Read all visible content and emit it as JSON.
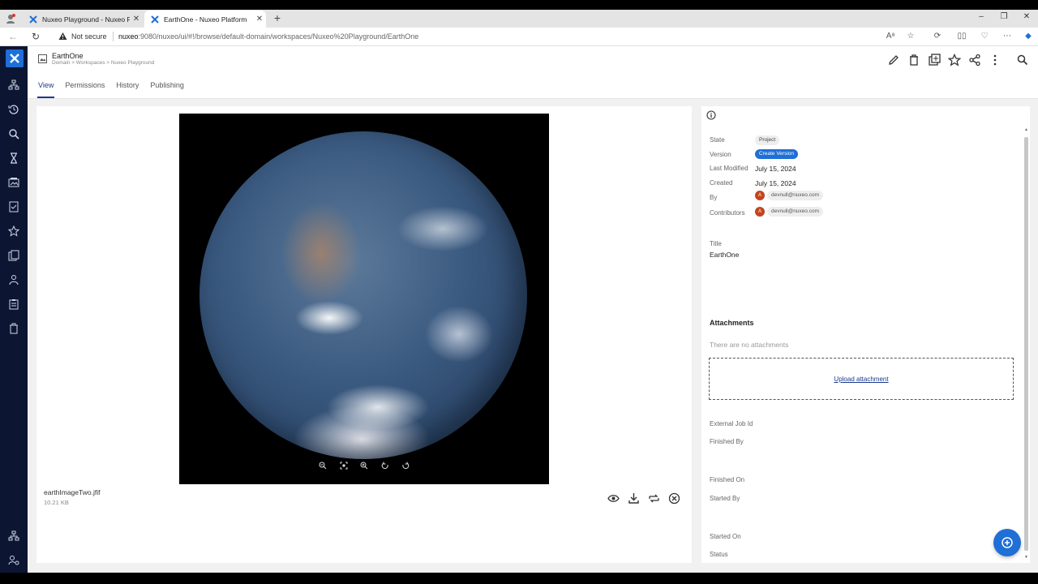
{
  "browser": {
    "tabs": [
      {
        "title": "Nuxeo Playground - Nuxeo Platf",
        "active": false
      },
      {
        "title": "EarthOne - Nuxeo Platform",
        "active": true
      }
    ],
    "security_label": "Not secure",
    "url_host": "nuxeo",
    "url_rest": ":9080/nuxeo/ui/#!/browse/default-domain/workspaces/Nuxeo%20Playground/EarthOne"
  },
  "document": {
    "title": "EarthOne",
    "breadcrumb": "Domain > Workspaces > Nuxeo Playground"
  },
  "view_tabs": [
    {
      "label": "View",
      "selected": true
    },
    {
      "label": "Permissions",
      "selected": false
    },
    {
      "label": "History",
      "selected": false
    },
    {
      "label": "Publishing",
      "selected": false
    }
  ],
  "viewer": {
    "file_name": "earthImageTwo.jfif",
    "file_size": "10.21 KB"
  },
  "panel": {
    "state_label": "State",
    "state_value": "Project",
    "version_label": "Version",
    "version_button": "Create Version",
    "last_modified_label": "Last Modified",
    "last_modified_value": "July 15, 2024",
    "created_label": "Created",
    "created_value": "July 15, 2024",
    "by_label": "By",
    "by_user": "devnull@nuxeo.com",
    "by_initial": "A",
    "contributors_label": "Contributors",
    "contributor_user": "devnull@nuxeo.com",
    "contributor_initial": "A",
    "title_label": "Title",
    "title_value": "EarthOne",
    "attachments_title": "Attachments",
    "no_attachments": "There are no attachments",
    "upload_label": "Upload attachment",
    "external_job_label": "External Job Id",
    "finished_by_label": "Finished By",
    "finished_on_label": "Finished On",
    "started_by_label": "Started By",
    "started_on_label": "Started On",
    "status_label": "Status"
  },
  "colors": {
    "nav_bg": "#0c1633",
    "accent": "#1f6fd6",
    "tab_active": "#1a3a8c",
    "avatar": "#c2451f"
  }
}
